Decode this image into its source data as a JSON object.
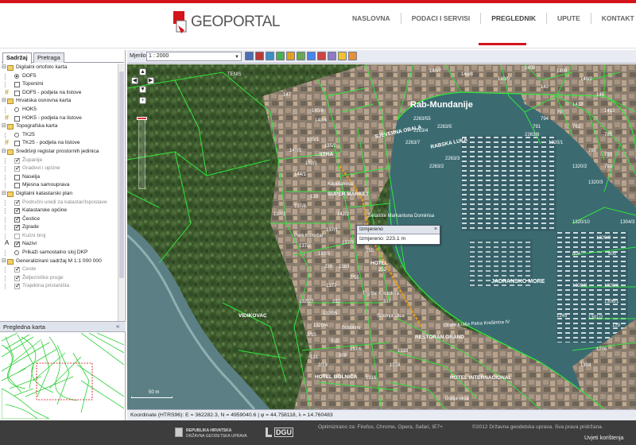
{
  "header": {
    "logo_text": "GEOPORTAL",
    "nav": [
      {
        "label": "NASLOVNA"
      },
      {
        "label": "PODACI I SERVISI"
      },
      {
        "label": "PREGLEDNIK"
      },
      {
        "label": "UPUTE"
      },
      {
        "label": "KONTAKT"
      }
    ],
    "active_nav": "PREGLEDNIK",
    "accent_color": "#d4141a"
  },
  "sidebar": {
    "tabs": [
      {
        "label": "Sadržaj"
      },
      {
        "label": "Pretraga"
      }
    ],
    "active_tab": "Sadržaj",
    "tree": [
      {
        "type": "group",
        "label": "Digitalni ortofoto karta",
        "level": 0
      },
      {
        "type": "radio",
        "label": "DOF5",
        "level": 1,
        "checked": true
      },
      {
        "type": "check",
        "label": "Toponimi",
        "level": 1,
        "checked": false
      },
      {
        "type": "check",
        "label": "DOF5 - podjela na listove",
        "level": 1,
        "checked": false,
        "icon": "grid"
      },
      {
        "type": "group",
        "label": "Hrvatska osnovna karta",
        "level": 0
      },
      {
        "type": "radio",
        "label": "HOK5",
        "level": 1,
        "checked": false
      },
      {
        "type": "check",
        "label": "HOK5 - podjela na listove",
        "level": 1,
        "checked": false,
        "icon": "grid"
      },
      {
        "type": "group",
        "label": "Topografska karta",
        "level": 0
      },
      {
        "type": "radio",
        "label": "TK25",
        "level": 1,
        "checked": false
      },
      {
        "type": "check",
        "label": "TK25 - podjela na listove",
        "level": 1,
        "checked": false,
        "icon": "grid"
      },
      {
        "type": "group",
        "label": "Središnji registar prostornih jedinica",
        "level": 0
      },
      {
        "type": "check",
        "label": "Županije",
        "level": 1,
        "checked": true,
        "disabled": true
      },
      {
        "type": "check",
        "label": "Gradovi i općine",
        "level": 1,
        "checked": true,
        "disabled": true
      },
      {
        "type": "check",
        "label": "Naselja",
        "level": 1,
        "checked": false
      },
      {
        "type": "check",
        "label": "Mjesna samouprava",
        "level": 1,
        "checked": false
      },
      {
        "type": "group",
        "label": "Digitalni katastarski plan",
        "level": 0
      },
      {
        "type": "check",
        "label": "Područni uredi za katastar/Ispostave",
        "level": 1,
        "checked": true,
        "disabled": true
      },
      {
        "type": "check",
        "label": "Katastarske općine",
        "level": 1,
        "checked": true
      },
      {
        "type": "check",
        "label": "Čestice",
        "level": 1,
        "checked": true
      },
      {
        "type": "check",
        "label": "Zgrade",
        "level": 1,
        "checked": true
      },
      {
        "type": "check",
        "label": "Kućni broj",
        "level": 1,
        "checked": false,
        "disabled": true
      },
      {
        "type": "check",
        "label": "Nazivi",
        "level": 1,
        "checked": true,
        "icon": "text-a"
      },
      {
        "type": "radio",
        "label": "Prikaži samostalno sloj DKP",
        "level": 1,
        "checked": false
      },
      {
        "type": "group",
        "label": "Generalizirani sadržaj M 1:1 000 000",
        "level": 0
      },
      {
        "type": "check",
        "label": "Ceste",
        "level": 1,
        "checked": true,
        "disabled": true
      },
      {
        "type": "check",
        "label": "Željezničke pruge",
        "level": 1,
        "checked": true,
        "disabled": true
      },
      {
        "type": "check",
        "label": "Trajektna pristaništa",
        "level": 1,
        "checked": true,
        "disabled": true
      }
    ],
    "overview_title": "Pregledna karta"
  },
  "toolbar": {
    "scale_label": "Mjerilo",
    "scale_value": "1 : 2000"
  },
  "map": {
    "popup_title": "Izmjereno",
    "popup_value": "Izmjereno: 223.1 m",
    "scalebar_label": "50 m",
    "labels": {
      "place": "Rab-Mundanije",
      "street1": "SJEVERNA OBALA",
      "street2": "RABSKA LUKA",
      "street3": "Šetalište Markantuna Dominisa",
      "supermarket": "SUPER MARKET",
      "park": "Park Komrčar",
      "hotel": "HOTEL",
      "jadransko": "JADRANSKO MORE",
      "vidikovac": "VIDIKOVAC",
      "obala": "Obala Kralja Petra Krešimira IV",
      "restoran": "RESTORAN GRAND",
      "hotel_int": "HOTEL INTERNACIONAL",
      "donja": "Donja ulica",
      "trg": "Trg Sv. Kristofora",
      "srednja": "Srednja ulica",
      "bobotine": "Bobotine",
      "tenis": "TENIS",
      "kapetan": "Kapetanova",
      "bolnica": "HOTEL BOLNICA",
      "ul": "...STRA"
    },
    "parcels": [
      "140/7",
      "140/8",
      "140/9",
      "1408",
      "1409",
      "140/2",
      "142",
      "145",
      "1413",
      "1412",
      "140/6",
      "140/4",
      "147",
      "135/1",
      "135/2",
      "140/3",
      "132/1",
      "144/1",
      "139",
      "137/3",
      "137/8",
      "137/2",
      "137/5",
      "137/1",
      "142/2",
      "137/3",
      "1383",
      "1377",
      "1320/1",
      "1320/2",
      "1320/3",
      "1320/10",
      "1320/9",
      "1320/6",
      "1320/8",
      "2263/55",
      "2263/4",
      "2263/5",
      "2263/7",
      "2263/3",
      "2263/2",
      "2263/8",
      "791",
      "792",
      "795",
      "793",
      "794",
      "797",
      "798",
      "799",
      "800",
      "804",
      "1301/2",
      "1245",
      "1296",
      "1304",
      "1306/1",
      "129",
      "1304/3",
      "1320/4",
      "1320/5",
      "1320/7",
      "3/10",
      "310",
      "309",
      "131",
      "2/19",
      "137/6",
      "232",
      "239",
      "2/55",
      "255",
      "215",
      "252",
      "317",
      "1333",
      "1318",
      "1316",
      "1300",
      "1301",
      "1297"
    ],
    "colors": {
      "parcel": "#31e33b",
      "measure": "#e39a1c",
      "sea": "#3b6b71"
    }
  },
  "statusbar": {
    "coords": "Koordinate (HTRS96): E = 362282.3, N = 4959040.6 | φ = 44.758118, λ = 14.760483"
  },
  "footer": {
    "rh_line1": "REPUBLIKA HRVATSKA",
    "rh_line2": "DRŽAVNA GEODETSKA UPRAVA",
    "dgu": "DGU",
    "optimized": "Optimizirano za: Firefox, Chrome, Opera, Safari, IE7+",
    "copyright": "©2012 Državna geodetska uprava. Sva prava pridržana.",
    "terms": "Uvjeti korištenja"
  }
}
